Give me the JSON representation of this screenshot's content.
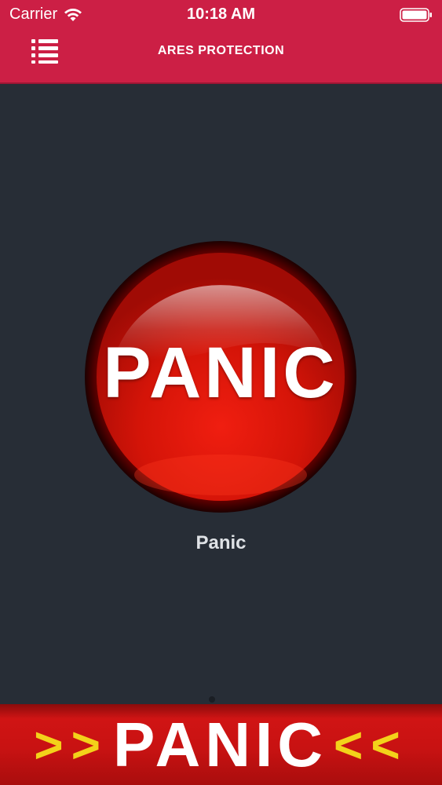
{
  "status_bar": {
    "carrier": "Carrier",
    "time": "10:18 AM",
    "icons": [
      "wifi-icon",
      "battery-icon"
    ]
  },
  "header": {
    "title": "ARES PROTECTION",
    "menu_icon": "menu-list-icon",
    "background_color": "#cc1f45"
  },
  "main": {
    "panic_button_text": "PANIC",
    "panic_label": "Panic",
    "button_color": "#d81b10",
    "background_color": "#272d36"
  },
  "bottom_banner": {
    "left_arrows": ">>",
    "text": "PANIC",
    "right_arrows": "<<",
    "arrow_color": "#f3d21a",
    "background_color": "#c81212"
  }
}
